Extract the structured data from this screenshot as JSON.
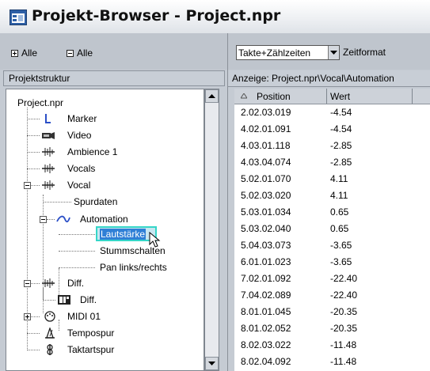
{
  "window": {
    "title": "Projekt-Browser - Project.npr"
  },
  "left_toolbar": {
    "expand_all": "Alle",
    "collapse_all": "Alle"
  },
  "tree": {
    "header": "Projektstruktur",
    "root": "Project.npr",
    "items": [
      {
        "label": "Marker",
        "icon": "marker-icon"
      },
      {
        "label": "Video",
        "icon": "video-icon"
      },
      {
        "label": "Ambience 1",
        "icon": "audio-track-icon"
      },
      {
        "label": "Vocals",
        "icon": "audio-track-icon"
      },
      {
        "label": "Vocal",
        "icon": "audio-track-icon"
      },
      {
        "label": "Spurdaten",
        "icon": ""
      },
      {
        "label": "Automation",
        "icon": "automation-icon"
      },
      {
        "label": "Lautstärke",
        "icon": ""
      },
      {
        "label": "Stummschalten",
        "icon": ""
      },
      {
        "label": "Pan links/rechts",
        "icon": ""
      },
      {
        "label": "Diff.",
        "icon": "audio-track-icon"
      },
      {
        "label": "Diff.",
        "icon": "part-icon"
      },
      {
        "label": "MIDI 01",
        "icon": "midi-icon"
      },
      {
        "label": "Tempospur",
        "icon": "tempo-icon"
      },
      {
        "label": "Taktartspur",
        "icon": "signature-icon"
      }
    ]
  },
  "right_toolbar": {
    "time_format_value": "Takte+Zählzeiten",
    "time_format_label": "Zeitformat"
  },
  "path_display": "Anzeige: Project.npr\\Vocal\\Automation",
  "table": {
    "columns": [
      "Position",
      "Wert"
    ],
    "rows": [
      [
        "2.02.03.019",
        "-4.54"
      ],
      [
        "4.02.01.091",
        "-4.54"
      ],
      [
        "4.03.01.118",
        "-2.85"
      ],
      [
        "4.03.04.074",
        "-2.85"
      ],
      [
        "5.02.01.070",
        "4.11"
      ],
      [
        "5.02.03.020",
        "4.11"
      ],
      [
        "5.03.01.034",
        "0.65"
      ],
      [
        "5.03.02.040",
        "0.65"
      ],
      [
        "5.04.03.073",
        "-3.65"
      ],
      [
        "6.01.01.023",
        "-3.65"
      ],
      [
        "7.02.01.092",
        "-22.40"
      ],
      [
        "7.04.02.089",
        "-22.40"
      ],
      [
        "8.01.01.045",
        "-20.35"
      ],
      [
        "8.01.02.052",
        "-20.35"
      ],
      [
        "8.02.03.022",
        "-11.48"
      ],
      [
        "8.02.04.092",
        "-11.48"
      ]
    ]
  }
}
